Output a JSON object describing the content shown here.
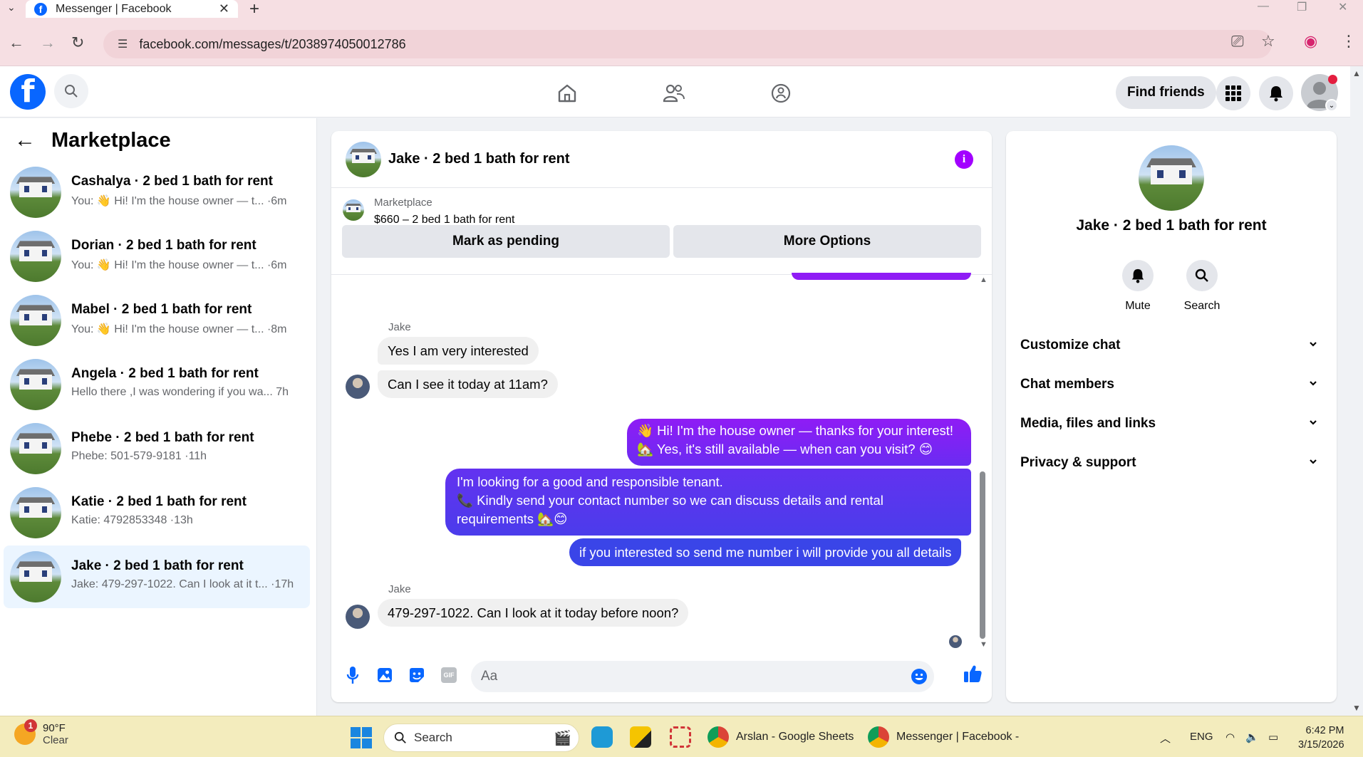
{
  "browser": {
    "tab_title": "Messenger | Facebook",
    "url": "facebook.com/messages/t/2038974050012786"
  },
  "header": {
    "find_friends": "Find friends"
  },
  "sidebar": {
    "title": "Marketplace",
    "conversations": [
      {
        "name": "Cashalya · 2 bed 1 bath for rent",
        "snippet": "You: 👋 Hi! I'm the house owner — t... ·6m"
      },
      {
        "name": "Dorian · 2 bed 1 bath for rent",
        "snippet": "You: 👋 Hi! I'm the house owner — t... ·6m"
      },
      {
        "name": "Mabel · 2 bed 1 bath for rent",
        "snippet": "You: 👋 Hi! I'm the house owner — t... ·8m"
      },
      {
        "name": "Angela · 2 bed 1 bath for rent",
        "snippet": "Hello there ,I was wondering if you wa... 7h"
      },
      {
        "name": "Phebe · 2 bed 1 bath for rent",
        "snippet": "Phebe: 501-579-9181 ·11h"
      },
      {
        "name": "Katie · 2 bed 1 bath for rent",
        "snippet": "Katie: 4792853348 ·13h"
      },
      {
        "name": "Jake · 2 bed 1 bath for rent",
        "snippet": "Jake: 479-297-1022. Can I look at it t... ·17h"
      }
    ]
  },
  "chat": {
    "title": "Jake · 2 bed 1 bath for rent",
    "marketplace_label": "Marketplace",
    "listing": "$660 – 2 bed 1 bath for rent",
    "mark_pending": "Mark as pending",
    "more_options": "More Options",
    "sender_1": "Jake",
    "in_1": "Yes I am very interested",
    "in_2": "Can I see it today at 11am?",
    "out_1_line1": "👋 Hi! I'm the house owner — thanks for your interest!",
    "out_1_line2": "🏡 Yes, it's still available — when can you visit? 😊",
    "out_2_line1": "I'm looking for a good and responsible tenant.",
    "out_2_line2": "📞 Kindly send your contact number so we can discuss details and rental",
    "out_2_line3": "requirements 🏡😊",
    "out_3": "if you interested so send me number i will provide you all details",
    "sender_2": "Jake",
    "in_3": "479-297-1022. Can I look at it today before noon?",
    "input_placeholder": "Aa",
    "gif_label": "GIF"
  },
  "details": {
    "title": "Jake · 2 bed 1 bath for rent",
    "mute": "Mute",
    "search": "Search",
    "sections": [
      "Customize chat",
      "Chat members",
      "Media, files and links",
      "Privacy & support"
    ]
  },
  "taskbar": {
    "temp": "90°F",
    "condition": "Clear",
    "weather_badge": "1",
    "search": "Search",
    "app_sheets": "Arslan - Google Sheets",
    "app_messenger": "Messenger | Facebook -",
    "lang": "ENG",
    "time": "6:42 PM",
    "date": "3/15/2026"
  },
  "colors": {
    "fb_blue": "#0866ff",
    "out_bubble_top": "#8f1cf5",
    "out_bubble_bottom": "#3a45e8",
    "tab_bar": "#f6dfe3",
    "taskbar": "#f3ecbd"
  }
}
